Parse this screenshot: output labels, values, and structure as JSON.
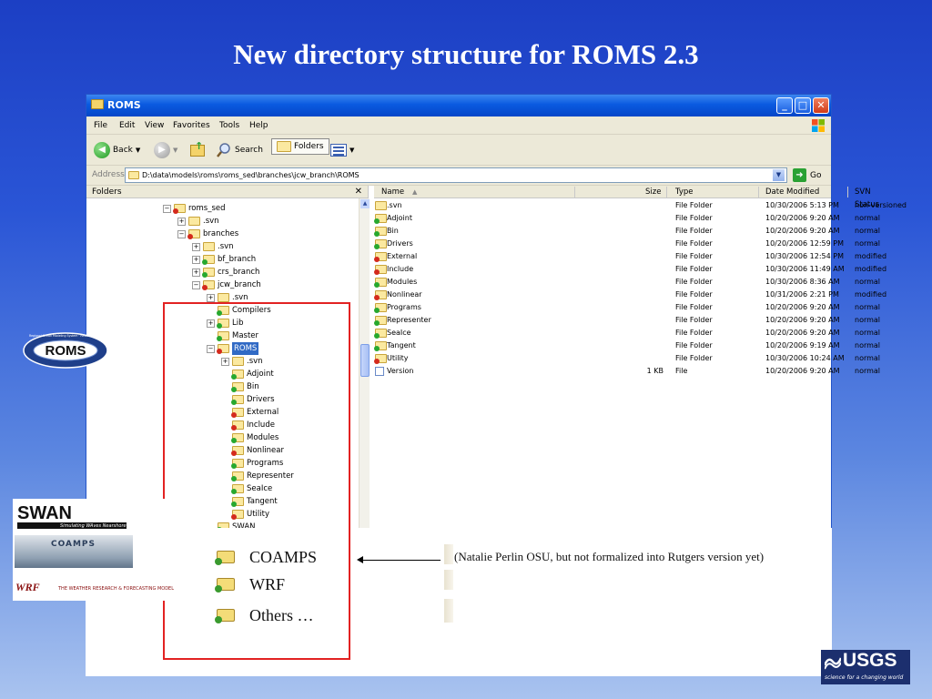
{
  "slide": {
    "title": "New directory structure for ROMS 2.3",
    "note": "(Natalie Perlin OSU, but not formalized into Rutgers version yet)",
    "added_items": [
      "COAMPS",
      "WRF",
      "Others …"
    ]
  },
  "window": {
    "title": "ROMS",
    "menu": [
      "File",
      "Edit",
      "View",
      "Favorites",
      "Tools",
      "Help"
    ],
    "toolbar": {
      "back": "Back",
      "search": "Search",
      "folders": "Folders"
    },
    "address": {
      "label": "Address",
      "value": "D:\\data\\models\\roms\\roms_sed\\branches\\jcw_branch\\ROMS",
      "go": "Go"
    }
  },
  "folders_pane": {
    "header": "Folders",
    "close": "✕",
    "tree": [
      {
        "label": "roms_sed",
        "level": 0,
        "expander": "−",
        "icon": "red"
      },
      {
        "label": ".svn",
        "level": 1,
        "expander": "+",
        "icon": "plain"
      },
      {
        "label": "branches",
        "level": 1,
        "expander": "−",
        "icon": "red"
      },
      {
        "label": ".svn",
        "level": 2,
        "expander": "+",
        "icon": "plain"
      },
      {
        "label": "bf_branch",
        "level": 2,
        "expander": "+",
        "icon": "green"
      },
      {
        "label": "crs_branch",
        "level": 2,
        "expander": "+",
        "icon": "green"
      },
      {
        "label": "jcw_branch",
        "level": 2,
        "expander": "−",
        "icon": "red"
      },
      {
        "label": ".svn",
        "level": 3,
        "expander": "+",
        "icon": "plain"
      },
      {
        "label": "Compilers",
        "level": 3,
        "expander": "",
        "icon": "green"
      },
      {
        "label": "Lib",
        "level": 3,
        "expander": "+",
        "icon": "green"
      },
      {
        "label": "Master",
        "level": 3,
        "expander": "",
        "icon": "green"
      },
      {
        "label": "ROMS",
        "level": 3,
        "expander": "−",
        "icon": "red",
        "selected": true
      },
      {
        "label": ".svn",
        "level": 4,
        "expander": "+",
        "icon": "plain"
      },
      {
        "label": "Adjoint",
        "level": 4,
        "expander": "",
        "icon": "green"
      },
      {
        "label": "Bin",
        "level": 4,
        "expander": "",
        "icon": "green"
      },
      {
        "label": "Drivers",
        "level": 4,
        "expander": "",
        "icon": "green"
      },
      {
        "label": "External",
        "level": 4,
        "expander": "",
        "icon": "red"
      },
      {
        "label": "Include",
        "level": 4,
        "expander": "",
        "icon": "red"
      },
      {
        "label": "Modules",
        "level": 4,
        "expander": "",
        "icon": "green"
      },
      {
        "label": "Nonlinear",
        "level": 4,
        "expander": "",
        "icon": "red"
      },
      {
        "label": "Programs",
        "level": 4,
        "expander": "",
        "icon": "green"
      },
      {
        "label": "Representer",
        "level": 4,
        "expander": "",
        "icon": "green"
      },
      {
        "label": "SeaIce",
        "level": 4,
        "expander": "",
        "icon": "green"
      },
      {
        "label": "Tangent",
        "level": 4,
        "expander": "",
        "icon": "green"
      },
      {
        "label": "Utility",
        "level": 4,
        "expander": "",
        "icon": "red"
      },
      {
        "label": "SWAN",
        "level": 3,
        "expander": "",
        "icon": "green"
      }
    ]
  },
  "file_list": {
    "columns": {
      "name": "Name",
      "size": "Size",
      "type": "Type",
      "date": "Date Modified",
      "svn": "SVN Status"
    },
    "rows": [
      {
        "name": ".svn",
        "size": "",
        "type": "File Folder",
        "date": "10/30/2006 5:13 PM",
        "svn": "non-versioned",
        "icon": "plain"
      },
      {
        "name": "Adjoint",
        "size": "",
        "type": "File Folder",
        "date": "10/20/2006 9:20 AM",
        "svn": "normal",
        "icon": "green"
      },
      {
        "name": "Bin",
        "size": "",
        "type": "File Folder",
        "date": "10/20/2006 9:20 AM",
        "svn": "normal",
        "icon": "green"
      },
      {
        "name": "Drivers",
        "size": "",
        "type": "File Folder",
        "date": "10/20/2006 12:59 PM",
        "svn": "normal",
        "icon": "green"
      },
      {
        "name": "External",
        "size": "",
        "type": "File Folder",
        "date": "10/30/2006 12:54 PM",
        "svn": "modified",
        "icon": "red"
      },
      {
        "name": "Include",
        "size": "",
        "type": "File Folder",
        "date": "10/30/2006 11:49 AM",
        "svn": "modified",
        "icon": "red"
      },
      {
        "name": "Modules",
        "size": "",
        "type": "File Folder",
        "date": "10/30/2006 8:36 AM",
        "svn": "normal",
        "icon": "green"
      },
      {
        "name": "Nonlinear",
        "size": "",
        "type": "File Folder",
        "date": "10/31/2006 2:21 PM",
        "svn": "modified",
        "icon": "red"
      },
      {
        "name": "Programs",
        "size": "",
        "type": "File Folder",
        "date": "10/20/2006 9:20 AM",
        "svn": "normal",
        "icon": "green"
      },
      {
        "name": "Representer",
        "size": "",
        "type": "File Folder",
        "date": "10/20/2006 9:20 AM",
        "svn": "normal",
        "icon": "green"
      },
      {
        "name": "SeaIce",
        "size": "",
        "type": "File Folder",
        "date": "10/20/2006 9:20 AM",
        "svn": "normal",
        "icon": "green"
      },
      {
        "name": "Tangent",
        "size": "",
        "type": "File Folder",
        "date": "10/20/2006 9:19 AM",
        "svn": "normal",
        "icon": "green"
      },
      {
        "name": "Utility",
        "size": "",
        "type": "File Folder",
        "date": "10/30/2006 10:24 AM",
        "svn": "normal",
        "icon": "red"
      },
      {
        "name": "Version",
        "size": "1 KB",
        "type": "File",
        "date": "10/20/2006 9:20 AM",
        "svn": "normal",
        "icon": "file"
      }
    ]
  },
  "logos": {
    "roms": "ROMS",
    "roms_ring": "Regional Ocean Modeling System · Research Community",
    "swan": "SWAN",
    "swan_sub": "Simulating WAves Nearshore",
    "coamps": "COAMPS",
    "wrf": "WRF",
    "wrf_sub": "THE WEATHER RESEARCH & FORECASTING MODEL",
    "usgs": "USGS",
    "usgs_sub": "science for a changing world"
  },
  "colors": {
    "accent": "#316ac5",
    "highlight_box": "#e22222",
    "svn_normal": "#27a82f",
    "svn_modified": "#d42a1c"
  }
}
